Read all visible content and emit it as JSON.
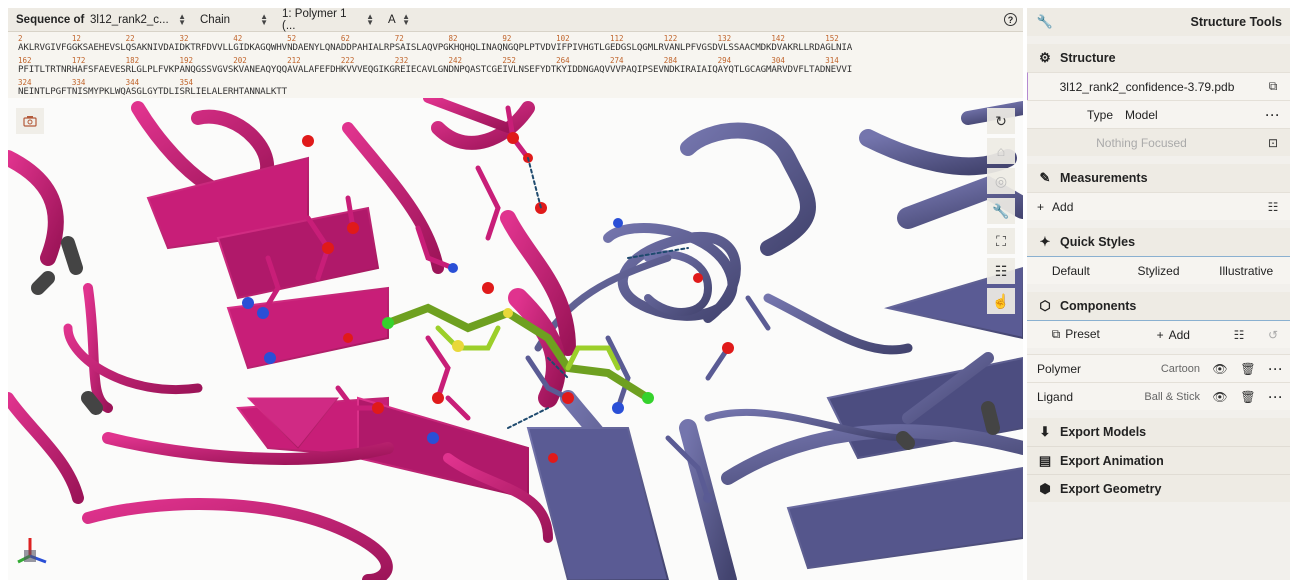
{
  "sequence_bar": {
    "label": "Sequence of",
    "entry": "3l12_rank2_c...",
    "mode": "Chain",
    "polymer": "1: Polymer 1 (...",
    "chain": "A"
  },
  "sequence": {
    "lines": [
      {
        "numbers": [
          "2",
          "12",
          "22",
          "32",
          "42",
          "52",
          "62",
          "72",
          "82",
          "92",
          "102",
          "112",
          "122",
          "132",
          "142",
          "152"
        ],
        "residues": "AKLRVGIVFGGKSAEHEVSLQSAKNIVDAIDKTRFDVVLLGIDKAGQWHVNDAENYLQNADDPAHIALRPSAISLAQVPGKHQHQLINAQNGQPLPTVDVIFPIVHGTLGEDGSLQGMLRVANLPFVGSDVLSSAACMDKDVAKRLLRDAGLNIA"
      },
      {
        "numbers": [
          "162",
          "172",
          "182",
          "192",
          "202",
          "212",
          "222",
          "232",
          "242",
          "252",
          "264",
          "274",
          "284",
          "294",
          "304",
          "314"
        ],
        "residues": "PFITLTRTNRHAFSFAEVESRLGLPLFVKPANQGSSVGVSKVANEAQYQQAVALAFEFDHKVVVEQGIKGREIECAVLGNDNPQASTCGEIVLNSEFYDTKYIDDNGAQVVVPAQIPSEVNDKIRAIAIQAYQTLGCAGMARVDVFLTADNEVVI"
      },
      {
        "numbers": [
          "324",
          "334",
          "344",
          "354"
        ],
        "residues": "NEINTLPGFTNISMYPKLWQASGLGYTDLISRLIELALERHTANNALKTT"
      }
    ]
  },
  "viewport": {
    "controls": [
      "reset-camera",
      "camera-snapshot",
      "toggle-animation",
      "structure-tools",
      "expand",
      "settings",
      "selection-mode"
    ]
  },
  "panel": {
    "title": "Structure Tools",
    "structure": {
      "header": "Structure",
      "file": "3l12_rank2_confidence-3.79.pdb",
      "type_label": "Type",
      "type_value": "Model",
      "focus": "Nothing Focused"
    },
    "measurements": {
      "header": "Measurements",
      "add": "Add"
    },
    "quick_styles": {
      "header": "Quick Styles",
      "options": [
        "Default",
        "Stylized",
        "Illustrative"
      ]
    },
    "components": {
      "header": "Components",
      "preset": "Preset",
      "add": "Add",
      "items": [
        {
          "name": "Polymer",
          "repr": "Cartoon"
        },
        {
          "name": "Ligand",
          "repr": "Ball & Stick"
        }
      ]
    },
    "exports": [
      "Export Models",
      "Export Animation",
      "Export Geometry"
    ]
  },
  "colors": {
    "chain_a": "#c81e78",
    "chain_b": "#5a5b94",
    "ligand": "#6ea020",
    "oxygen": "#e01a1a",
    "nitrogen": "#2a4fd6"
  }
}
